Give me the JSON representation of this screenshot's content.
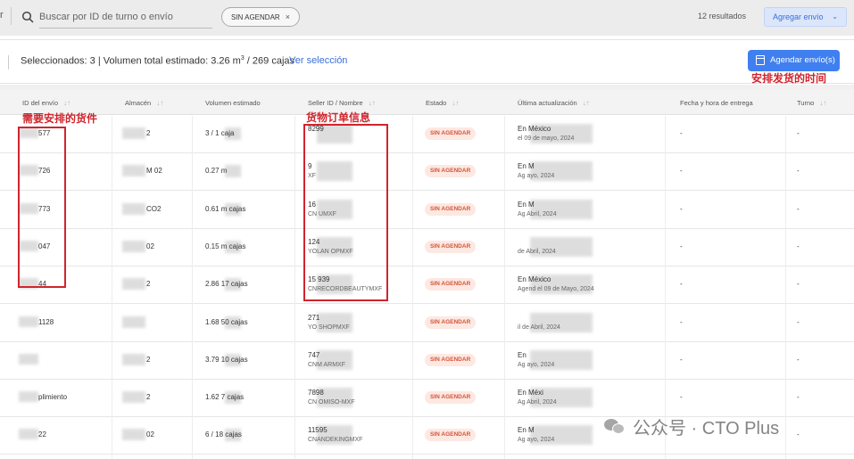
{
  "topbar": {
    "left_fragment": "r",
    "search_placeholder": "Buscar por ID de turno o envío",
    "filter_chip": "SIN AGENDAR",
    "chip_close": "×",
    "results_count": "12 resultados",
    "add_button": "Agregar envío",
    "add_chevron": "⌄"
  },
  "selection": {
    "summary_before": "Seleccionados: 3 | Volumen total estimado: 3.26 m",
    "summary_sup": "3",
    "summary_after": " / 269 cajas",
    "view_link": "Ver selección",
    "schedule_button": "Agendar envío(s)"
  },
  "table": {
    "headers": [
      "ID del envío",
      "Almacén",
      "Volumen estimado",
      "Seller ID / Nombre",
      "Estado",
      "Última actualización",
      "Fecha y hora de entrega",
      "Turno"
    ],
    "sort_glyph": "↓↑",
    "rows": [
      {
        "id": "577",
        "wh": "2",
        "vol": "3 / 1 caja",
        "seller_id": "8299",
        "seller_name": "",
        "status": "SIN AGENDAR",
        "upd1": "En México",
        "upd2": "el 09 de mayo, 2024",
        "fecha": "-",
        "turno": "-"
      },
      {
        "id": "726",
        "wh": "M   02",
        "vol": "0.27 m",
        "seller_id": "9",
        "seller_name": "XF",
        "status": "SIN AGENDAR",
        "upd1": "En M",
        "upd2": "Ag                 ayo, 2024",
        "fecha": "-",
        "turno": "-"
      },
      {
        "id": "773",
        "wh": "CO2",
        "vol": "0.61 m     cajas",
        "seller_id": "16",
        "seller_name": "CN          UMXF",
        "status": "SIN AGENDAR",
        "upd1": "En M",
        "upd2": "Ag              Abril, 2024",
        "fecha": "-",
        "turno": "-"
      },
      {
        "id": "047",
        "wh": "02",
        "vol": "0.15 m      cajas",
        "seller_id": "124",
        "seller_name": "YOLAN      OPMXF",
        "status": "SIN AGENDAR",
        "upd1": "",
        "upd2": "de Abril, 2024",
        "fecha": "-",
        "turno": "-"
      },
      {
        "id": "44",
        "wh": "2",
        "vol": "2.86     17 cajas",
        "seller_id": "15       939",
        "seller_name": "CNRECORDBEAUTYMXF",
        "status": "SIN AGENDAR",
        "upd1": "En México",
        "upd2": "Agend          el 09 de Mayo, 2024",
        "fecha": "-",
        "turno": "-"
      },
      {
        "id": "1128",
        "wh": "",
        "vol": "1.68     50 cajas",
        "seller_id": "271",
        "seller_name": "YO       SHOPMXF",
        "status": "SIN AGENDAR",
        "upd1": "",
        "upd2": "il de Abril, 2024",
        "fecha": "-",
        "turno": "-"
      },
      {
        "id": "",
        "wh": "2",
        "vol": "3.79     10 cajas",
        "seller_id": "747",
        "seller_name": "CNM       ARMXF",
        "status": "SIN AGENDAR",
        "upd1": "En",
        "upd2": "Ag                 ayo, 2024",
        "fecha": "-",
        "turno": "-"
      },
      {
        "id": "plimiento",
        "wh": "2",
        "vol": "1.62     7 cajas",
        "seller_id": "7898",
        "seller_name": "CN      OMISO-MXF",
        "status": "SIN AGENDAR",
        "upd1": "En Méxi",
        "upd2": "Ag                Abril, 2024",
        "fecha": "-",
        "turno": "-"
      },
      {
        "id": "22",
        "wh": "02",
        "vol": "6      / 18 cajas",
        "seller_id": "11595",
        "seller_name": "CNANDEKINGMXF",
        "status": "SIN AGENDAR",
        "upd1": "En M",
        "upd2": "Ag                ayo, 2024",
        "fecha": "-",
        "turno": "-"
      }
    ]
  },
  "annotations": {
    "goods_label": "需要安排的货件",
    "order_info_label": "货物订单信息",
    "ship_time_label": "安排发货的时间"
  },
  "watermark": {
    "text": "公众号 · CTO Plus"
  },
  "colors": {
    "accent": "#3f7ff0",
    "status_bg": "#fde8e2",
    "status_fg": "#d4553a",
    "annotation": "#d0252d"
  }
}
